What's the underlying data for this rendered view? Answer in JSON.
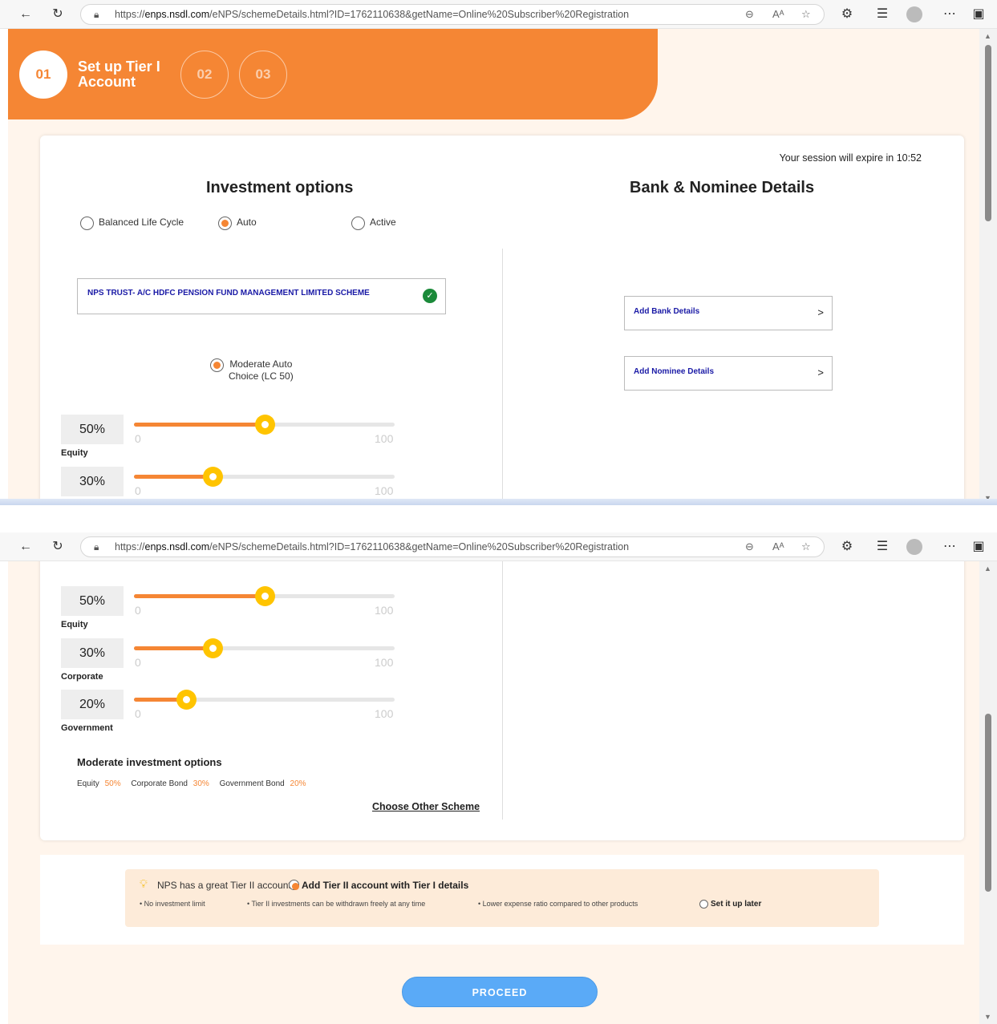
{
  "browser": {
    "url_prefix": "https://",
    "url_host": "enps.nsdl.com",
    "url_path": "/eNPS/schemeDetails.html?ID=1762110638&getName=Online%20Subscriber%20Registration"
  },
  "steps": {
    "step1_num": "01",
    "step1_title_line1": "Set up Tier I",
    "step1_title_line2": "Account",
    "step2_num": "02",
    "step3_num": "03"
  },
  "session": "Your session will expire in 10:52",
  "investment": {
    "heading": "Investment options",
    "options": [
      "Balanced Life Cycle",
      "Auto",
      "Active"
    ],
    "selected_option": "Auto",
    "scheme_name": "NPS TRUST- A/C HDFC PENSION FUND MANAGEMENT LIMITED SCHEME",
    "choice_line1": "Moderate Auto",
    "choice_line2": "Choice (LC 50)",
    "slider_min": "0",
    "slider_max": "100",
    "allocations": [
      {
        "pct": "50%",
        "label": "Equity",
        "value": 50
      },
      {
        "pct": "30%",
        "label": "Corporate",
        "value": 30
      },
      {
        "pct": "20%",
        "label": "Government",
        "value": 20
      }
    ],
    "summary_title": "Moderate investment options",
    "summary": [
      {
        "name": "Equity",
        "pct": "50%"
      },
      {
        "name": "Corporate Bond",
        "pct": "30%"
      },
      {
        "name": "Government Bond",
        "pct": "20%"
      }
    ],
    "choose_other": "Choose Other Scheme"
  },
  "bank": {
    "heading": "Bank & Nominee Details",
    "add_bank": "Add Bank Details",
    "add_nominee": "Add Nominee Details",
    "chevron": ">"
  },
  "tier2": {
    "prompt": "NPS has a great Tier II account",
    "add_option": "Add Tier II account with Tier I details",
    "bullets": [
      "No investment limit",
      "Tier II investments can be withdrawn freely at any time",
      "Lower expense ratio compared to other products"
    ],
    "later_option": "Set it up later"
  },
  "proceed": "PROCEED",
  "colors": {
    "accent": "#f58634",
    "knob": "#ffc400",
    "button": "#5aaaf7",
    "link": "#1a1aa6"
  }
}
